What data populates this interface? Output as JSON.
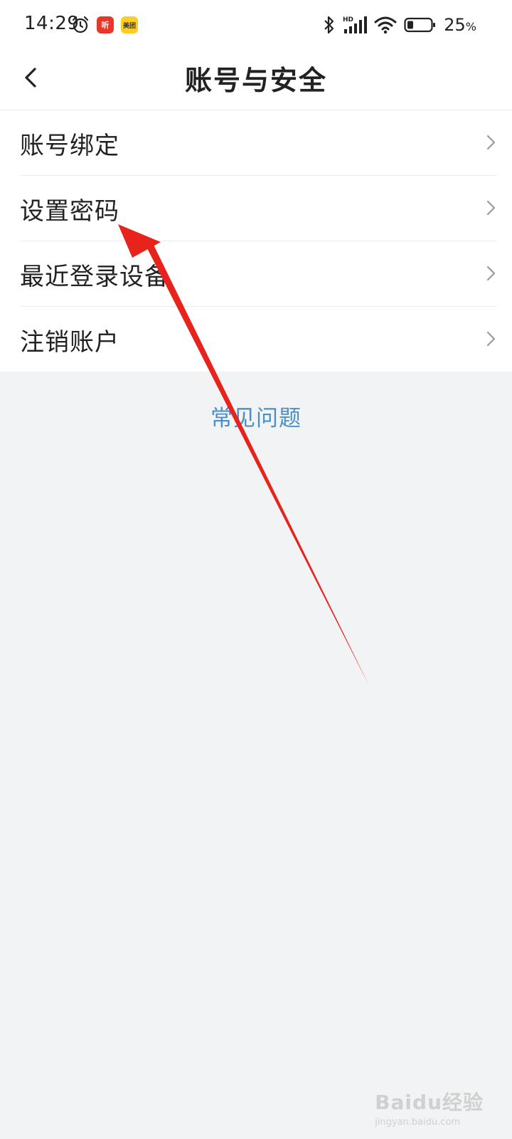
{
  "status_bar": {
    "time": "14:29",
    "battery_percent": "25",
    "battery_unit": "%",
    "network_label": "HD",
    "apps": [
      {
        "icon": "ximalaya-app-icon",
        "label": "听",
        "color": "#e8362b"
      },
      {
        "icon": "meituan-app-icon",
        "label": "美团",
        "color": "#ffcc22"
      }
    ]
  },
  "header": {
    "title": "账号与安全"
  },
  "menu": {
    "items": [
      {
        "label": "账号绑定"
      },
      {
        "label": "设置密码"
      },
      {
        "label": "最近登录设备"
      },
      {
        "label": "注销账户"
      }
    ]
  },
  "faq": {
    "label": "常见问题"
  },
  "watermark": {
    "logo": "Baidu经验",
    "sub": "jingyan.baidu.com"
  },
  "colors": {
    "background": "#f2f3f5",
    "card": "#ffffff",
    "link": "#4a8fc9",
    "annotation": "#e8231c"
  }
}
